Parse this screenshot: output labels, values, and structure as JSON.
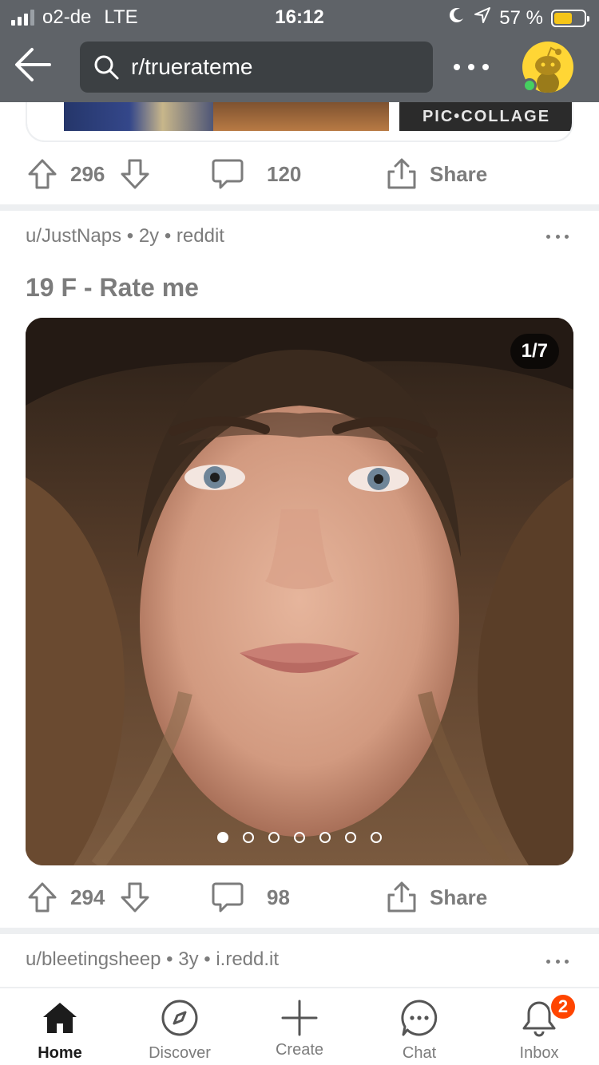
{
  "status_bar": {
    "carrier": "o2-de",
    "network": "LTE",
    "time": "16:12",
    "battery_percent": "57 %",
    "battery_level": 0.57
  },
  "header": {
    "search_text": "r/truerateme"
  },
  "previous_post": {
    "watermark": "PIC•COLLAGE",
    "upvotes": "296",
    "comments": "120",
    "share_label": "Share"
  },
  "post": {
    "author": "u/JustNaps",
    "age": "2y",
    "source": "reddit",
    "title": "19 F - Rate me",
    "gallery_counter": "1/7",
    "gallery_total": 7,
    "gallery_current": 1,
    "upvotes": "294",
    "comments": "98",
    "share_label": "Share"
  },
  "next_post": {
    "author": "u/bleetingsheep",
    "age": "3y",
    "source": "i.redd.it"
  },
  "tabs": [
    {
      "label": "Home",
      "icon": "home-icon"
    },
    {
      "label": "Discover",
      "icon": "compass-icon"
    },
    {
      "label": "Create",
      "icon": "plus-icon"
    },
    {
      "label": "Chat",
      "icon": "chat-icon"
    },
    {
      "label": "Inbox",
      "icon": "bell-icon",
      "badge": "2"
    }
  ],
  "colors": {
    "header_bg": "#5f6368",
    "accent": "#ff4500",
    "meta_text": "#7c7c7c",
    "online_dot": "#46d160"
  }
}
